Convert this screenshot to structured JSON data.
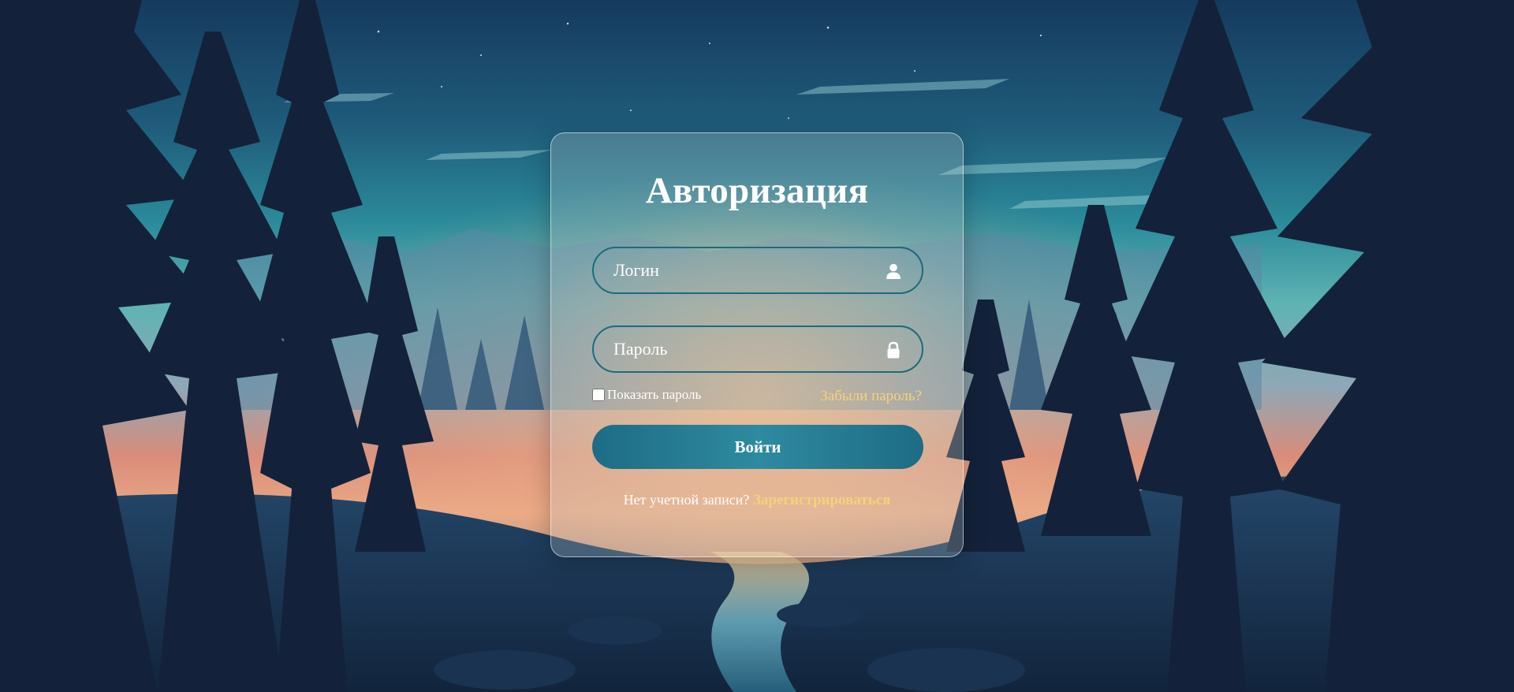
{
  "background": {
    "description_icon": "forest-night-scene"
  },
  "login_card": {
    "title": "Авторизация",
    "login_field": {
      "placeholder": "Логин",
      "value": "",
      "icon": "user-icon"
    },
    "password_field": {
      "placeholder": "Пароль",
      "value": "",
      "icon": "lock-icon"
    },
    "show_password_label": "Показать пароль",
    "show_password_checked": false,
    "forgot_password_link": "Забыли пароль?",
    "submit_label": "Войти",
    "no_account_text": "Нет учетной записи?",
    "register_link": "Зарегистрироваться"
  },
  "colors": {
    "accent_link": "#f4d27a",
    "button": "#2e8aa0",
    "field_border": "#1d6b7b"
  }
}
